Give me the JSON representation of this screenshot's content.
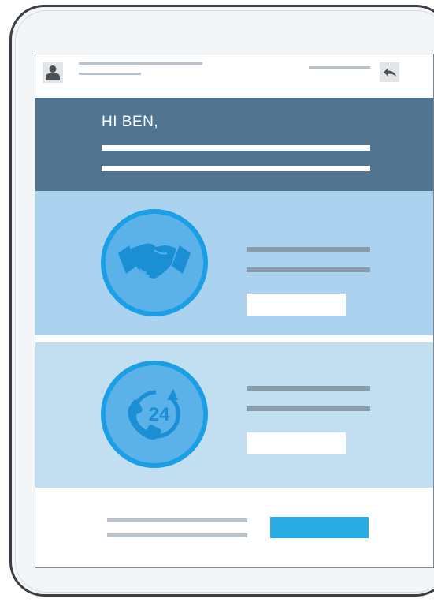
{
  "header": {
    "avatar_icon": "user-avatar-icon",
    "reply_icon": "reply-arrow-icon"
  },
  "greeting": {
    "text": "HI BEN,"
  },
  "features": [
    {
      "icon": "handshake-icon"
    },
    {
      "icon": "phone-24-hour-icon",
      "icon_text": "24"
    }
  ],
  "colors": {
    "greeting_band": "#517590",
    "feature_1_bg": "#abd2ee",
    "feature_2_bg": "#c2dff1",
    "circle_fill": "#5bb2e8",
    "circle_stroke": "#1a9ee6",
    "cta_button": "#2aace2"
  }
}
